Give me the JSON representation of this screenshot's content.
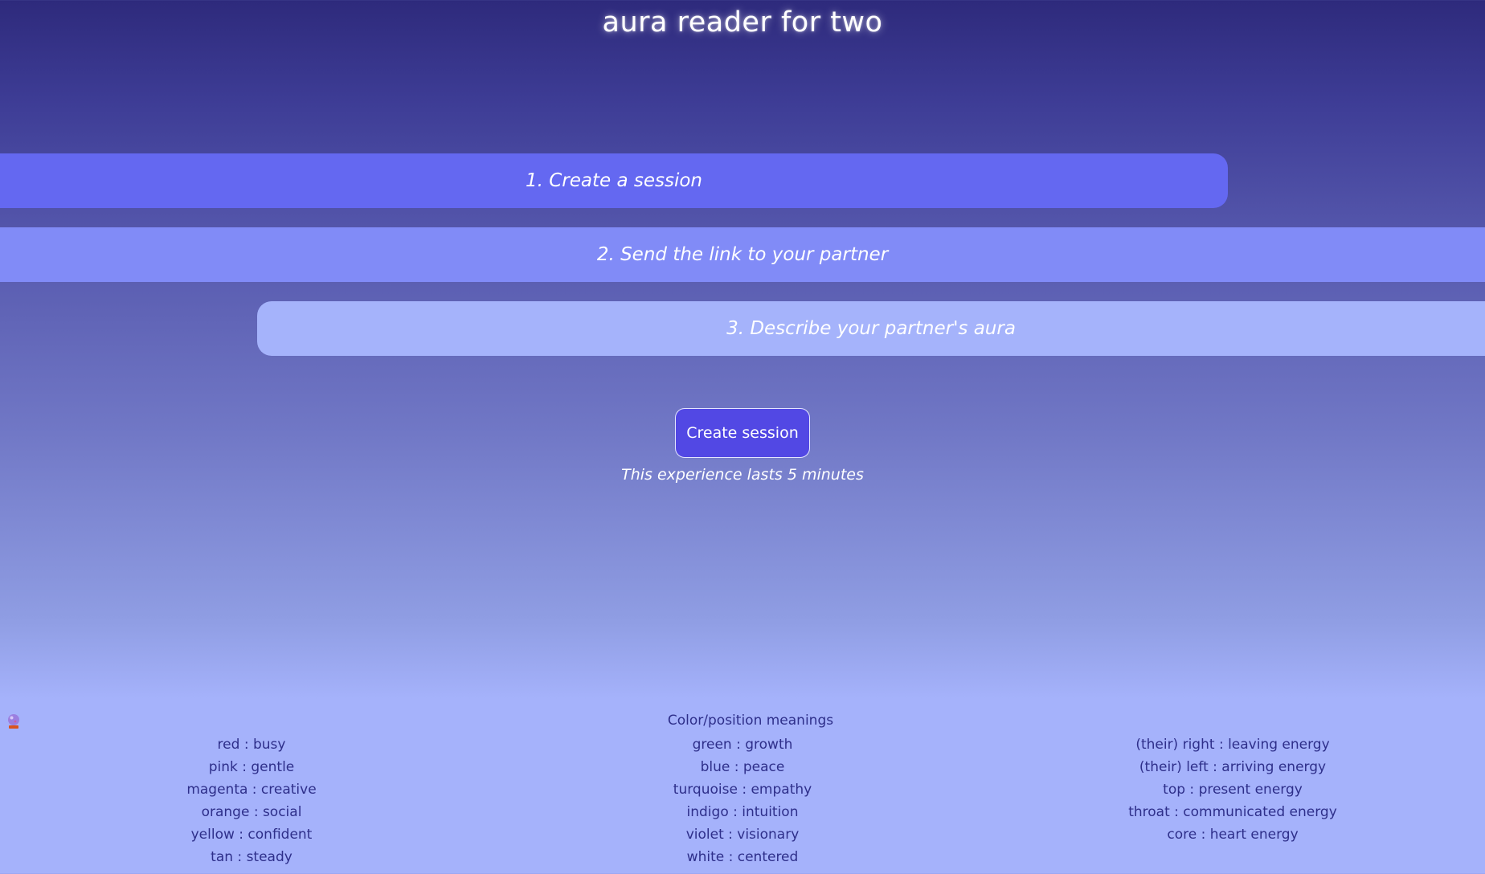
{
  "app": {
    "title": "aura reader for two"
  },
  "steps": [
    {
      "label": "1. Create a session"
    },
    {
      "label": "2. Send the link to your partner"
    },
    {
      "label": "3. Describe your partner's aura"
    }
  ],
  "actions": {
    "create_session_label": "Create session",
    "duration_note": "This experience lasts 5 minutes"
  },
  "legend": {
    "heading": "Color/position meanings",
    "left": [
      "red : busy",
      "pink : gentle",
      "magenta : creative",
      "orange : social",
      "yellow : confident",
      "tan : steady"
    ],
    "middle": [
      "green : growth",
      "blue : peace",
      "turquoise : empathy",
      "indigo : intuition",
      "violet : visionary",
      "white : centered"
    ],
    "right": [
      "(their) right : leaving energy",
      "(their) left : arriving energy",
      "top : present energy",
      "throat : communicated energy",
      "core : heart energy"
    ]
  },
  "icons": {
    "logo": "crystal-ball-icon"
  },
  "colors": {
    "background_top": "#2e2a7c",
    "background_bottom": "#a5b2fb",
    "step1_bg": "#6468f1",
    "step2_bg": "#818bf7",
    "step3_bg": "#a5b3fb",
    "button_bg": "#5248e4",
    "legend_text": "#2e2f8a"
  }
}
